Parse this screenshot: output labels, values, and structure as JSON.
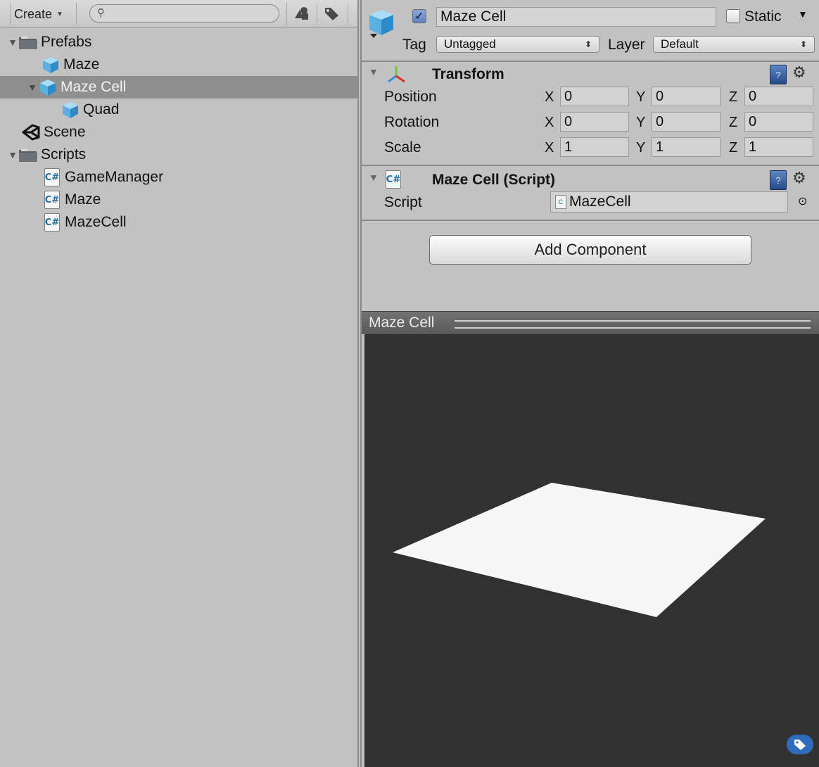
{
  "project": {
    "create_label": "Create",
    "search_placeholder": "",
    "tree": [
      {
        "label": "Prefabs",
        "type": "folder",
        "expanded": true,
        "depth": 0
      },
      {
        "label": "Maze",
        "type": "prefab",
        "depth": 1
      },
      {
        "label": "Maze Cell",
        "type": "prefab",
        "expanded": true,
        "selected": true,
        "depth": 1
      },
      {
        "label": "Quad",
        "type": "prefab",
        "depth": 2
      },
      {
        "label": "Scene",
        "type": "scene",
        "depth": 0
      },
      {
        "label": "Scripts",
        "type": "folder",
        "expanded": true,
        "depth": 0
      },
      {
        "label": "GameManager",
        "type": "script",
        "depth": 1
      },
      {
        "label": "Maze",
        "type": "script",
        "depth": 1
      },
      {
        "label": "MazeCell",
        "type": "script",
        "depth": 1
      }
    ]
  },
  "inspector": {
    "object_name": "Maze Cell",
    "active": true,
    "static_label": "Static",
    "static_checked": false,
    "tag_label": "Tag",
    "tag_value": "Untagged",
    "layer_label": "Layer",
    "layer_value": "Default",
    "transform": {
      "title": "Transform",
      "rows": [
        {
          "label": "Position",
          "x": "0",
          "y": "0",
          "z": "0"
        },
        {
          "label": "Rotation",
          "x": "0",
          "y": "0",
          "z": "0"
        },
        {
          "label": "Scale",
          "x": "1",
          "y": "1",
          "z": "1"
        }
      ],
      "axis_x": "X",
      "axis_y": "Y",
      "axis_z": "Z"
    },
    "script_component": {
      "title": "Maze Cell (Script)",
      "script_label": "Script",
      "script_value": "MazeCell"
    },
    "add_component_label": "Add Component",
    "preview_title": "Maze Cell",
    "help_glyph": "?"
  }
}
